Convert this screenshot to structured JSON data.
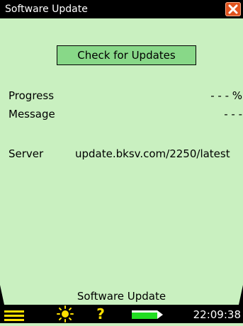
{
  "window": {
    "title": "Software Update"
  },
  "actions": {
    "check_label": "Check for Updates"
  },
  "fields": {
    "progress_label": "Progress",
    "progress_value": "- - - %",
    "message_label": "Message",
    "message_value": "- - -",
    "server_label": "Server",
    "server_value": "update.bksv.com/2250/latest"
  },
  "footer": {
    "page_label": "Software Update"
  },
  "statusbar": {
    "icons": [
      "menu-icon",
      "backlight-icon",
      "help-icon",
      "battery-icon"
    ],
    "time": "22:09:38"
  },
  "colors": {
    "background": "#c9f0c0",
    "button": "#88d888",
    "close": "#e0531d",
    "help": "#ffe000",
    "battery": "#22dd22"
  }
}
